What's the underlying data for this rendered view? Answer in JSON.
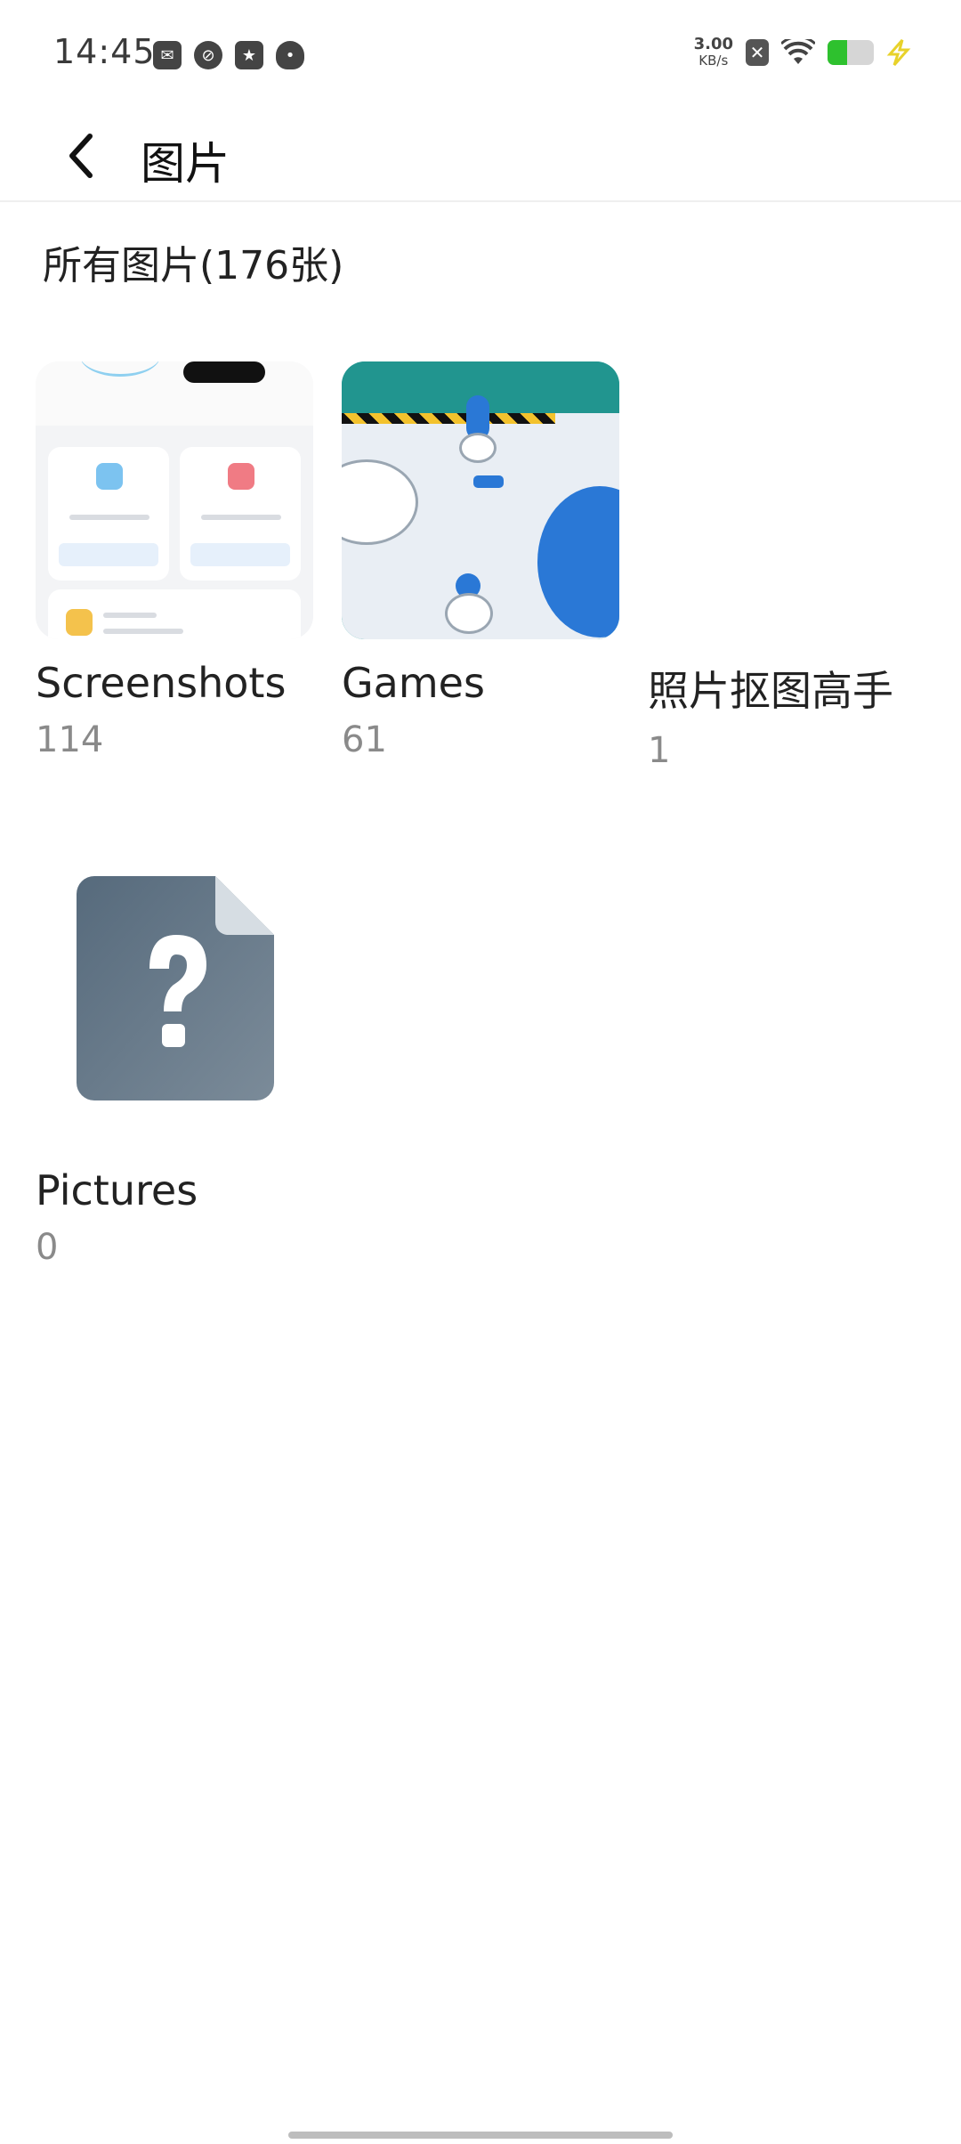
{
  "status_bar": {
    "time": "14:45",
    "net_speed_value": "3.00",
    "net_speed_unit": "KB/s",
    "battery_level": 0.42,
    "icons": [
      "notification-app-icon",
      "notification-app-icon",
      "notification-app-icon",
      "notification-app-icon",
      "sim-off-icon",
      "wifi-icon",
      "battery-icon",
      "charging-icon"
    ]
  },
  "header": {
    "title": "图片",
    "back_icon": "chevron-left-icon"
  },
  "section": {
    "title": "所有图片(176张)"
  },
  "albums": [
    {
      "name": "Screenshots",
      "count": "114"
    },
    {
      "name": "Games",
      "count": "61"
    },
    {
      "name": "照片抠图高手",
      "count": "1"
    },
    {
      "name": "Pictures",
      "count": "0"
    }
  ],
  "colors": {
    "battery_fill": "#2ec12e",
    "charge_bolt": "#e8d22a",
    "file_icon": "#5f7284"
  }
}
